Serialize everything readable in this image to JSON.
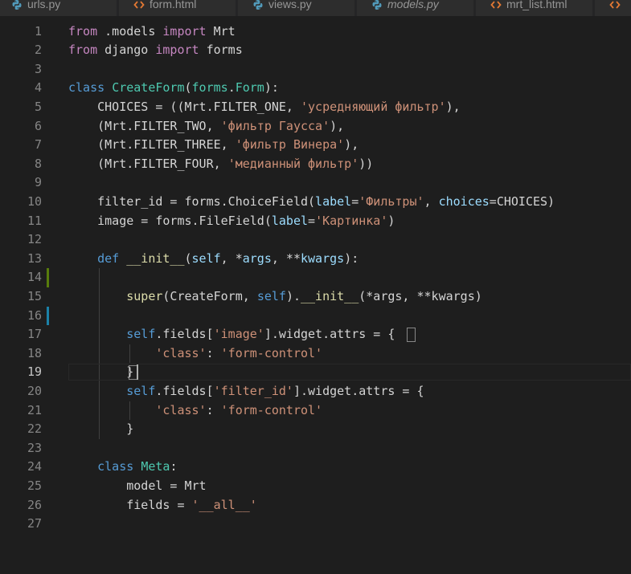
{
  "tabs": [
    {
      "label": "urls.py",
      "icon": "python-icon",
      "italic": false
    },
    {
      "label": "form.html",
      "icon": "html-icon",
      "italic": false
    },
    {
      "label": "views.py",
      "icon": "python-icon",
      "italic": false
    },
    {
      "label": "models.py",
      "icon": "python-icon",
      "italic": true
    },
    {
      "label": "mrt_list.html",
      "icon": "html-icon",
      "italic": false
    },
    {
      "label": "",
      "icon": "html-icon",
      "italic": false
    }
  ],
  "colors": {
    "keyword": "#569cd6",
    "control": "#c586c0",
    "string": "#ce9178",
    "class": "#4ec9b0",
    "function": "#dcdcaa",
    "variable": "#9cdcfe",
    "plain": "#d4d4d4",
    "gutter_modified": "#1b81a8",
    "gutter_added": "#587c0c",
    "python_icon": "#519aba",
    "html_icon": "#e37933"
  },
  "editor": {
    "active_line": 19,
    "lines": [
      {
        "n": "1",
        "tokens": [
          [
            "ctl",
            "from"
          ],
          [
            "pl",
            " .models "
          ],
          [
            "ctl",
            "import"
          ],
          [
            "pl",
            " Mrt"
          ]
        ]
      },
      {
        "n": "2",
        "tokens": [
          [
            "ctl",
            "from"
          ],
          [
            "pl",
            " django "
          ],
          [
            "ctl",
            "import"
          ],
          [
            "pl",
            " forms"
          ]
        ]
      },
      {
        "n": "3",
        "tokens": []
      },
      {
        "n": "4",
        "tokens": [
          [
            "kw",
            "class"
          ],
          [
            "pl",
            " "
          ],
          [
            "cls",
            "CreateForm"
          ],
          [
            "pl",
            "("
          ],
          [
            "cls",
            "forms"
          ],
          [
            "pl",
            "."
          ],
          [
            "cls",
            "Form"
          ],
          [
            "pl",
            "):"
          ]
        ]
      },
      {
        "n": "5",
        "tokens": [
          [
            "pl",
            "    CHOICES = ((Mrt.FILTER_ONE, "
          ],
          [
            "str",
            "'усредняющий фильтр'"
          ],
          [
            "pl",
            "),"
          ]
        ]
      },
      {
        "n": "6",
        "tokens": [
          [
            "pl",
            "    (Mrt.FILTER_TWO, "
          ],
          [
            "str",
            "'фильтр Гаусса'"
          ],
          [
            "pl",
            "),"
          ]
        ]
      },
      {
        "n": "7",
        "tokens": [
          [
            "pl",
            "    (Mrt.FILTER_THREE, "
          ],
          [
            "str",
            "'фильтр Винера'"
          ],
          [
            "pl",
            "),"
          ]
        ]
      },
      {
        "n": "8",
        "tokens": [
          [
            "pl",
            "    (Mrt.FILTER_FOUR, "
          ],
          [
            "str",
            "'медианный фильтр'"
          ],
          [
            "pl",
            "))"
          ]
        ]
      },
      {
        "n": "9",
        "tokens": []
      },
      {
        "n": "10",
        "tokens": [
          [
            "pl",
            "    filter_id = forms.ChoiceField("
          ],
          [
            "var",
            "label"
          ],
          [
            "pl",
            "="
          ],
          [
            "str",
            "'Фильтры'"
          ],
          [
            "pl",
            ", "
          ],
          [
            "var",
            "choices"
          ],
          [
            "pl",
            "=CHOICES)"
          ]
        ]
      },
      {
        "n": "11",
        "tokens": [
          [
            "pl",
            "    image = forms.FileField("
          ],
          [
            "var",
            "label"
          ],
          [
            "pl",
            "="
          ],
          [
            "str",
            "'Картинка'"
          ],
          [
            "pl",
            ")"
          ]
        ]
      },
      {
        "n": "12",
        "tokens": []
      },
      {
        "n": "13",
        "tokens": [
          [
            "pl",
            "    "
          ],
          [
            "kw",
            "def"
          ],
          [
            "pl",
            " "
          ],
          [
            "fn",
            "__init__"
          ],
          [
            "pl",
            "("
          ],
          [
            "var",
            "self"
          ],
          [
            "pl",
            ", *"
          ],
          [
            "var",
            "args"
          ],
          [
            "pl",
            ", **"
          ],
          [
            "var",
            "kwargs"
          ],
          [
            "pl",
            "):"
          ]
        ]
      },
      {
        "n": "14",
        "tokens": []
      },
      {
        "n": "15",
        "tokens": [
          [
            "pl",
            "        "
          ],
          [
            "fn",
            "super"
          ],
          [
            "pl",
            "(CreateForm, "
          ],
          [
            "kw",
            "self"
          ],
          [
            "pl",
            ")."
          ],
          [
            "fn",
            "__init__"
          ],
          [
            "pl",
            "(*args, **kwargs)"
          ]
        ]
      },
      {
        "n": "16",
        "tokens": []
      },
      {
        "n": "17",
        "tokens": [
          [
            "pl",
            "        "
          ],
          [
            "kw",
            "self"
          ],
          [
            "pl",
            ".fields["
          ],
          [
            "str",
            "'image'"
          ],
          [
            "pl",
            "].widget.attrs = {"
          ]
        ]
      },
      {
        "n": "18",
        "tokens": [
          [
            "pl",
            "            "
          ],
          [
            "str",
            "'class'"
          ],
          [
            "pl",
            ": "
          ],
          [
            "str",
            "'form-control'"
          ]
        ]
      },
      {
        "n": "19",
        "tokens": [
          [
            "pl",
            "        }"
          ]
        ]
      },
      {
        "n": "20",
        "tokens": [
          [
            "pl",
            "        "
          ],
          [
            "kw",
            "self"
          ],
          [
            "pl",
            ".fields["
          ],
          [
            "str",
            "'filter_id'"
          ],
          [
            "pl",
            "].widget.attrs = {"
          ]
        ]
      },
      {
        "n": "21",
        "tokens": [
          [
            "pl",
            "            "
          ],
          [
            "str",
            "'class'"
          ],
          [
            "pl",
            ": "
          ],
          [
            "str",
            "'form-control'"
          ]
        ]
      },
      {
        "n": "22",
        "tokens": [
          [
            "pl",
            "        }"
          ]
        ]
      },
      {
        "n": "23",
        "tokens": []
      },
      {
        "n": "24",
        "tokens": [
          [
            "pl",
            "    "
          ],
          [
            "kw",
            "class"
          ],
          [
            "pl",
            " "
          ],
          [
            "cls",
            "Meta"
          ],
          [
            "pl",
            ":"
          ]
        ]
      },
      {
        "n": "25",
        "tokens": [
          [
            "pl",
            "        model = Mrt"
          ]
        ]
      },
      {
        "n": "26",
        "tokens": [
          [
            "pl",
            "        fields = "
          ],
          [
            "str",
            "'__all__'"
          ]
        ]
      },
      {
        "n": "27",
        "tokens": []
      }
    ]
  }
}
